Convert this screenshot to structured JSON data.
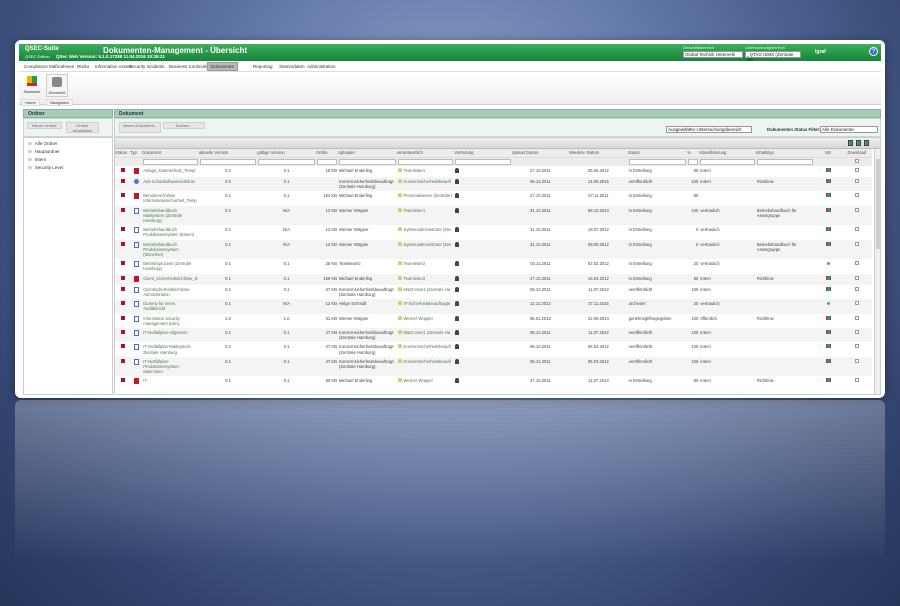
{
  "title": {
    "app": "QSEC-Suite",
    "edition": "QSEC Edition",
    "version": "QSec Web Version: 5.1.0.17288 11.04.2016 10:26:21",
    "heading": "Dokumenten-Management - Übersicht",
    "gb_label": "Geschäftsbereich",
    "gb_value": "Global Technik Unternehi",
    "ub_label": "Untersuchungsbereich",
    "ub_value": "_QTAG ISMS (Zentrale Ha",
    "user": "lgraf",
    "help": "?"
  },
  "menu": [
    "Compliance",
    "Maßnahmen",
    "Risiko",
    "Information Assets",
    "Security Incidents",
    "Business Continuity",
    "Dokumente",
    "Reporting",
    "Stammdaten",
    "Administration"
  ],
  "ribbon": {
    "startseite": "Startseite",
    "uebersicht": "Übersicht",
    "home": "Home",
    "navigation": "Navigation"
  },
  "ordner": {
    "title": "Ordner",
    "new": "Neuer Ordner",
    "edit": "Ordner bearbeiten",
    "tree": [
      "Alle Ordner",
      "Hauptordner",
      "Intern",
      "Security Level"
    ]
  },
  "dokument": {
    "title": "Dokument",
    "new": "Neues Dokument...",
    "search": "Suchen...",
    "area_select": "Ausgewählter Untersuchungsbereich",
    "status_filter_label": "Dokumenten Status Filter:",
    "status_filter": "Alle Dokumente"
  },
  "columns": [
    "Status",
    "Typ",
    "Dokument",
    "aktuelle Version",
    "gültige Version",
    "Größe",
    "Uploader",
    "Verantwortlich",
    "Vertretung",
    "Upload Datum",
    "Wiederv.-Datum",
    "Status",
    "%",
    "Klassifizierung",
    "Inhaltstyp",
    "UB",
    "Download"
  ],
  "rows": [
    {
      "typ": "pdf",
      "doc": "Anlage_Datenschutz_Templ",
      "av": "0.1",
      "gv": "0.1",
      "size": "16 KB",
      "up": "Michael Enderling",
      "ver": "Teamleiter1",
      "ud": "27.10.2011",
      "wd": "25.06.2012",
      "st": "in Erstellung",
      "p": "80",
      "kl": "intern",
      "it": "",
      "ub": "multi"
    },
    {
      "typ": "web",
      "doc": "Anti-Schadsoftwarerichtlinie",
      "av": "0.0",
      "gv": "0.1",
      "size": "",
      "up": "Konzernsicherheitsbeauftragt (Zentrale Hamburg)",
      "ver": "Konzernsicherheitsbeauft",
      "ud": "06.12.2011",
      "wd": "14.09.2015",
      "st": "veröffentlicht",
      "p": "100",
      "kl": "intern",
      "it": "Richtlinie",
      "ub": "multi"
    },
    {
      "typ": "pdf",
      "doc": "Benutzerrichtlinie Informationssicherheit_Temp",
      "av": "0.1",
      "gv": "0.1",
      "size": "164 KB",
      "up": "Michael Enderling",
      "ver": "Personalwesen (Zentrale I",
      "ud": "27.10.2011",
      "wd": "07.11.2011",
      "st": "in Erstellung",
      "p": "80",
      "kl": "",
      "it": "",
      "ub": "multi"
    },
    {
      "typ": "doc",
      "doc": "Betriebshandbuch Mailsystem (Zentrale Hamburg)",
      "av": "0.1",
      "gv": "N/A",
      "size": "12 KB",
      "up": "Werner Wüpper",
      "ver": "Teamleiter1",
      "ud": "31.10.2011",
      "wd": "08.10.2013",
      "st": "in Erstellung",
      "p": "100",
      "kl": "vertraulich",
      "it": "Betriebshandbuch für Assetgruppe",
      "ub": "multi"
    },
    {
      "typ": "doc",
      "doc": "Betriebshandbuch Produktionssystem (Essen)",
      "av": "0.1",
      "gv": "N/A",
      "size": "12 KB",
      "up": "Werner Wüpper",
      "ver": "Systemadministrator (Zen",
      "ud": "31.10.2011",
      "wd": "19.07.2012",
      "st": "in Erstellung",
      "p": "0",
      "kl": "vertraulich",
      "it": "",
      "ub": "multi"
    },
    {
      "typ": "doc",
      "doc": "Betriebshandbuch Produktionssystem (München)",
      "av": "0.1",
      "gv": "N/A",
      "size": "12 KB",
      "up": "Werner Wüpper",
      "ver": "Systemadministrator (Zen",
      "ud": "31.10.2011",
      "wd": "09.09.2012",
      "st": "in Erstellung",
      "p": "0",
      "kl": "vertraulich",
      "it": "Betriebshandbuch für Assetgruppe",
      "ub": "multi"
    },
    {
      "typ": "doc",
      "doc": "Betriebsprozess (Zentrale Hamburg)",
      "av": "0.1",
      "gv": "0.1",
      "size": "25 KB",
      "up": "Teamleiter2",
      "ver": "Teamleiter2",
      "ud": "04.11.2011",
      "wd": "02.02.2012",
      "st": "in Erstellung",
      "p": "20",
      "kl": "vertraulich",
      "it": "",
      "ub": "green"
    },
    {
      "typ": "pdf",
      "doc": "Client_Sicherheitsrichtlinie_D",
      "av": "0.1",
      "gv": "0.1",
      "size": "159 KB",
      "up": "Michael Enderling",
      "ver": "Teamleiter2",
      "ud": "27.10.2011",
      "wd": "16.04.2012",
      "st": "in Erstellung",
      "p": "80",
      "kl": "intern",
      "it": "Richtlinie",
      "ub": "multi"
    },
    {
      "typ": "doc",
      "doc": "Clientsicherheitsrichtlinie-Administration",
      "av": "0.1",
      "gv": "0.1",
      "size": "27 KB",
      "up": "Konzernsicherheitsbeauftragt (Zentrale Hamburg)",
      "ver": "M&O-User1 (Zentrale Ha",
      "ud": "06.12.2011",
      "wd": "11.07.2013",
      "st": "veröffentlicht",
      "p": "100",
      "kl": "intern",
      "it": "",
      "ub": "multi"
    },
    {
      "typ": "doc",
      "doc": "Dummy für einen Auditbericht",
      "av": "0.1",
      "gv": "N/A",
      "size": "12 KB",
      "up": "Helge Schmidt",
      "ver": "IT-Sicherheitsbeauftragte",
      "ud": "12.11.2012",
      "wd": "27.11.2015",
      "st": "archiviert",
      "p": "20",
      "kl": "vertraulich",
      "it": "",
      "ub": "green"
    },
    {
      "typ": "doc",
      "doc": "Information security management policy",
      "av": "1.0",
      "gv": "1.0",
      "size": "31 KB",
      "up": "Werner Wüpper",
      "ver": "Werner Wüpper",
      "ud": "06.01.2013",
      "wd": "22.09.2014",
      "st": "genehmigt/freigegeben",
      "p": "100",
      "kl": "öffentlich",
      "it": "Richtlinie",
      "ub": "multi"
    },
    {
      "typ": "doc",
      "doc": "IT-Notfallplan-Allgemein",
      "av": "0.1",
      "gv": "0.1",
      "size": "27 KB",
      "up": "Konzernsicherheitsbeauftragt (Zentrale Hamburg)",
      "ver": "M&O-User1 (Zentrale Ha",
      "ud": "06.12.2011",
      "wd": "11.07.2013",
      "st": "veröffentlicht",
      "p": "100",
      "kl": "intern",
      "it": "",
      "ub": "multi"
    },
    {
      "typ": "doc",
      "doc": "IT-Notfallplan-Mailsystem-Zentrale Hamburg",
      "av": "0.1",
      "gv": "0.1",
      "size": "27 KB",
      "up": "Konzernsicherheitsbeauftragt (Zentrale Hamburg)",
      "ver": "Konzernsicherheitsbeauft",
      "ud": "06.12.2011",
      "wd": "05.03.2012",
      "st": "veröffentlicht",
      "p": "100",
      "kl": "intern",
      "it": "",
      "ub": "multi"
    },
    {
      "typ": "doc",
      "doc": "IT-Notfallplan-Produktionssystem-Muenchen",
      "av": "0.1",
      "gv": "0.1",
      "size": "27 KB",
      "up": "Konzernsicherheitsbeauftragt (Zentrale Hamburg)",
      "ver": "Konzernsicherheitsbeauft",
      "ud": "06.12.2011",
      "wd": "05.03.2012",
      "st": "veröffentlicht",
      "p": "100",
      "kl": "intern",
      "it": "",
      "ub": "multi"
    },
    {
      "typ": "pdf",
      "doc": "IT-",
      "av": "0.1",
      "gv": "0.1",
      "size": "50 KB",
      "up": "Michael Enderling",
      "ver": "Werner Wüpper",
      "ud": "27.10.2011",
      "wd": "11.07.2013",
      "st": "in Erstellung",
      "p": "80",
      "kl": "intern",
      "it": "Richtlinie",
      "ub": "multi"
    }
  ]
}
